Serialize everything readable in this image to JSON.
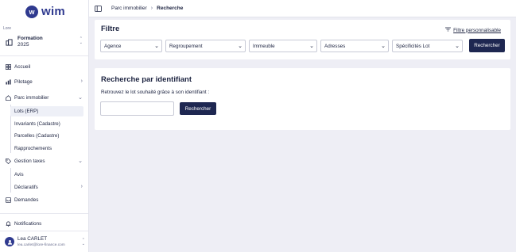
{
  "brand": {
    "name": "wim",
    "mark": "w"
  },
  "org": {
    "label": "Lore",
    "name": "Formation",
    "year": "2025"
  },
  "nav": {
    "accueil": "Accueil",
    "pilotage": "Pilotage",
    "parc": "Parc immobilier",
    "parc_items": [
      "Lots (ERP)",
      "Invariants (Cadastre)",
      "Parcelles (Cadastre)",
      "Rapprochements"
    ],
    "gestion": "Gestion taxes",
    "gestion_items": [
      "Avis",
      "Déclaratifs"
    ],
    "demandes": "Demandes",
    "notifications": "Notifications"
  },
  "user": {
    "name": "Lea CARLET",
    "email": "lea.carlet@lore-finance.com"
  },
  "breadcrumb": {
    "parent": "Parc immobilier",
    "current": "Recherche"
  },
  "filter": {
    "title": "Filtre",
    "custom_link": "Filtre personnalisable",
    "selects": [
      "Agence",
      "Regroupement",
      "Immeuble",
      "Adresses",
      "Spécificités Lot"
    ],
    "search_button": "Rechercher"
  },
  "id_search": {
    "title": "Recherche par identifiant",
    "description": "Retrouvez le lot souhaité grâce à son identifiant :",
    "input_value": "",
    "search_button": "Rechercher"
  },
  "colors": {
    "primary": "#1e2751",
    "brand": "#2f3a8f",
    "background": "#eeeef5"
  }
}
